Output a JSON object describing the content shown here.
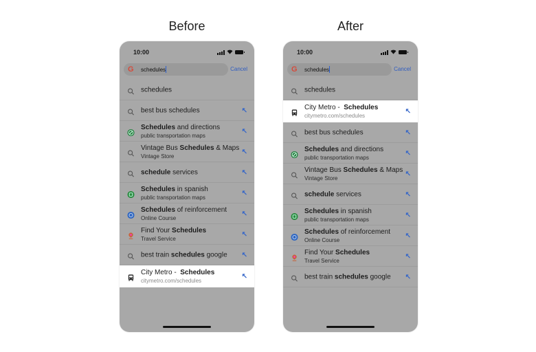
{
  "colors": {
    "phone_bg": "#a8a8a8",
    "highlight_bg": "#ffffff",
    "accent": "#3566c8"
  },
  "panels": [
    {
      "heading": "Before",
      "time": "10:00",
      "query": "schedules",
      "cancel": "Cancel",
      "rows": [
        {
          "icon": "search-icon",
          "title": [
            {
              "t": "schedules",
              "b": false
            }
          ],
          "arrow": false
        },
        {
          "icon": "search-icon",
          "title": [
            {
              "t": "best bus schedules",
              "b": false
            }
          ],
          "arrow": true
        },
        {
          "icon": "compass-icon",
          "title": [
            {
              "t": "Schedules",
              "b": true
            },
            {
              "t": " and directions",
              "b": false
            }
          ],
          "sub": "public transportation maps",
          "arrow": true
        },
        {
          "icon": "search-icon",
          "title": [
            {
              "t": "Vintage Bus ",
              "b": false
            },
            {
              "t": "Schedules",
              "b": true
            },
            {
              "t": " & Maps",
              "b": false
            }
          ],
          "sub": "Vintage Store",
          "arrow": true
        },
        {
          "icon": "search-icon",
          "title": [
            {
              "t": "schedule",
              "b": true
            },
            {
              "t": " services",
              "b": false
            }
          ],
          "arrow": true
        },
        {
          "icon": "green-app-icon",
          "title": [
            {
              "t": "Schedules",
              "b": true
            },
            {
              "t": " in spanish",
              "b": false
            }
          ],
          "sub": "public transportation maps",
          "arrow": true
        },
        {
          "icon": "blue-app-icon",
          "title": [
            {
              "t": "Schedules",
              "b": true
            },
            {
              "t": " of reinforcement",
              "b": false
            }
          ],
          "sub": "Online Course",
          "arrow": true
        },
        {
          "icon": "location-pin-icon",
          "title": [
            {
              "t": "Find Your ",
              "b": false
            },
            {
              "t": "Schedules",
              "b": true
            }
          ],
          "sub": "Travel Service",
          "arrow": true
        },
        {
          "icon": "search-icon",
          "title": [
            {
              "t": "best train ",
              "b": false
            },
            {
              "t": "schedules",
              "b": true
            },
            {
              "t": " google",
              "b": false
            }
          ],
          "arrow": true
        },
        {
          "icon": "bus-icon",
          "highlight": true,
          "title": [
            {
              "t": "City Metro -  ",
              "b": false
            },
            {
              "t": "Schedules",
              "b": true
            }
          ],
          "sub": "citymetro.com/schedules",
          "arrow": true
        }
      ]
    },
    {
      "heading": "After",
      "time": "10:00",
      "query": "schedules",
      "cancel": "Cancel",
      "rows": [
        {
          "icon": "search-icon",
          "title": [
            {
              "t": "schedules",
              "b": false
            }
          ],
          "arrow": false
        },
        {
          "icon": "bus-icon",
          "highlight": true,
          "title": [
            {
              "t": "City Metro -  ",
              "b": false
            },
            {
              "t": "Schedules",
              "b": true
            }
          ],
          "sub": "citymetro.com/schedules",
          "arrow": true
        },
        {
          "icon": "search-icon",
          "title": [
            {
              "t": "best bus schedules",
              "b": false
            }
          ],
          "arrow": true
        },
        {
          "icon": "compass-icon",
          "title": [
            {
              "t": "Schedules",
              "b": true
            },
            {
              "t": " and directions",
              "b": false
            }
          ],
          "sub": "public transportation maps",
          "arrow": true
        },
        {
          "icon": "search-icon",
          "title": [
            {
              "t": "Vintage Bus ",
              "b": false
            },
            {
              "t": "Schedules",
              "b": true
            },
            {
              "t": " & Maps",
              "b": false
            }
          ],
          "sub": "Vintage Store",
          "arrow": true
        },
        {
          "icon": "search-icon",
          "title": [
            {
              "t": "schedule",
              "b": true
            },
            {
              "t": " services",
              "b": false
            }
          ],
          "arrow": true
        },
        {
          "icon": "green-app-icon",
          "title": [
            {
              "t": "Schedules",
              "b": true
            },
            {
              "t": " in spanish",
              "b": false
            }
          ],
          "sub": "public transportation maps",
          "arrow": true
        },
        {
          "icon": "blue-app-icon",
          "title": [
            {
              "t": "Schedules",
              "b": true
            },
            {
              "t": " of reinforcement",
              "b": false
            }
          ],
          "sub": "Online Course",
          "arrow": true
        },
        {
          "icon": "location-pin-icon",
          "title": [
            {
              "t": "Find Your ",
              "b": false
            },
            {
              "t": "Schedules",
              "b": true
            }
          ],
          "sub": "Travel Service",
          "arrow": true
        },
        {
          "icon": "search-icon",
          "title": [
            {
              "t": "best train ",
              "b": false
            },
            {
              "t": "schedules",
              "b": true
            },
            {
              "t": " google",
              "b": false
            }
          ],
          "arrow": true
        }
      ]
    }
  ]
}
